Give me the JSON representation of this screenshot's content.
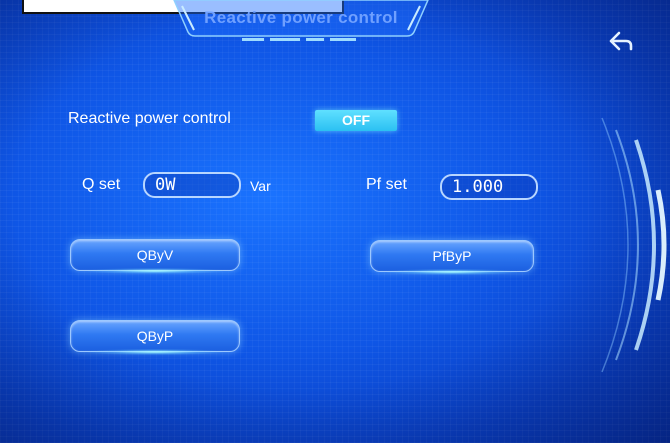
{
  "header": {
    "title": "Reactive power control"
  },
  "reactive_power_control": {
    "label": "Reactive power control",
    "toggle_value": "OFF"
  },
  "q_set": {
    "label": "Q set",
    "value": "0W",
    "unit": "Var"
  },
  "pf_set": {
    "label": "Pf set",
    "value": "1.000"
  },
  "buttons": {
    "qbyv": "QByV",
    "pfbyp": "PfByP",
    "qbyp": "QByP"
  },
  "colors": {
    "background": "#0f56e6",
    "toggle": "#2bc0f2",
    "title": "#6fa0ff",
    "text": "#ffffff"
  },
  "icons": {
    "back": "back-arrow-icon"
  }
}
